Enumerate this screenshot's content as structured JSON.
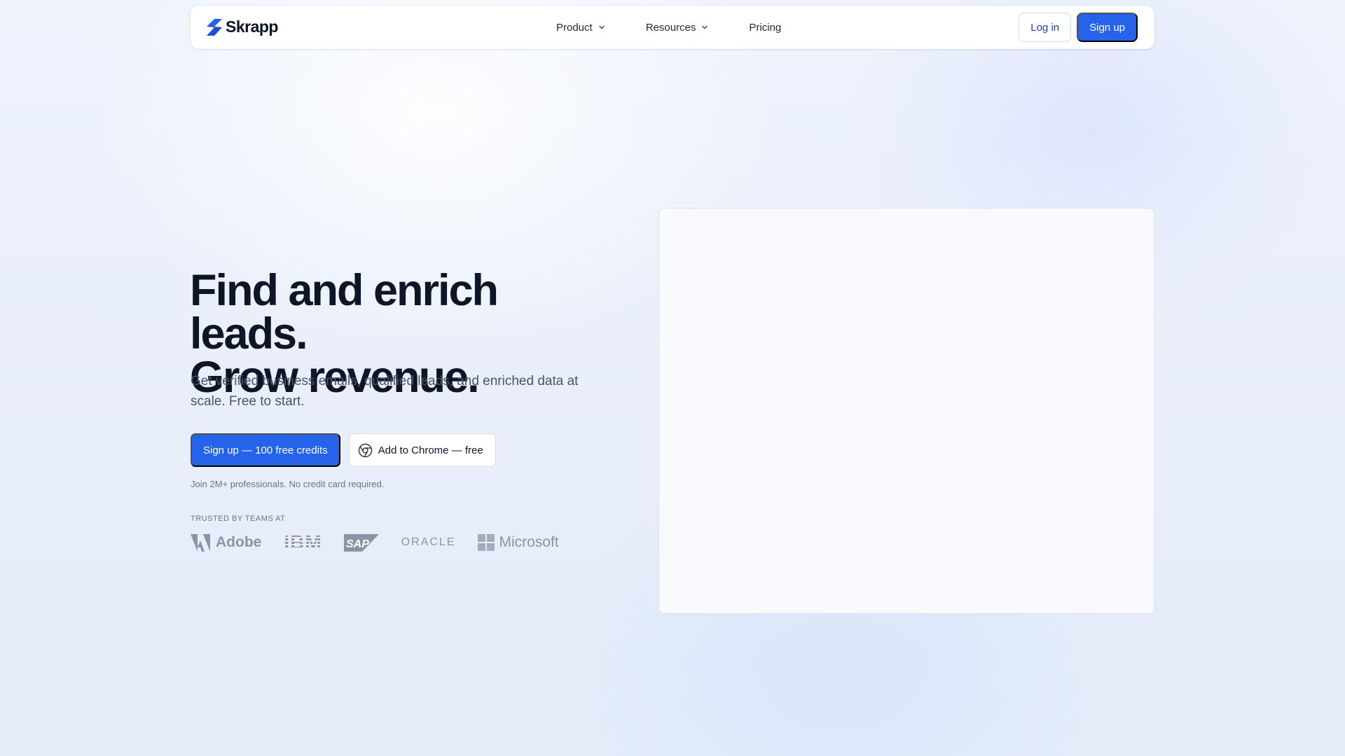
{
  "nav": {
    "brand": "Skrapp",
    "links": [
      {
        "label": "Product",
        "dropdown": true
      },
      {
        "label": "Resources",
        "dropdown": true
      },
      {
        "label": "Pricing",
        "dropdown": false
      }
    ],
    "login_label": "Log in",
    "signup_label": "Sign up"
  },
  "hero": {
    "title_line1": "Find and enrich leads.",
    "title_line2": "Grow revenue.",
    "subtitle": "Get verified business emails, qualified leads, and enriched data at scale. Free to start.",
    "primary_cta": "Sign up — 100 free credits",
    "secondary_cta": "Add to Chrome — free",
    "note": "Join 2M+ professionals. No credit card required."
  },
  "trusted": {
    "label": "TRUSTED BY TEAMS AT",
    "brands": [
      "Adobe",
      "IBM",
      "SAP",
      "ORACLE",
      "Microsoft"
    ]
  },
  "colors": {
    "accent": "#2563eb",
    "text_dark": "#0d1526",
    "text_muted": "#475569",
    "logo_gray": "#8a94a6"
  },
  "icons": {
    "brand_logo": "skrapp-logo-icon",
    "dropdown": "chevron-down-icon",
    "chrome": "chrome-icon"
  }
}
